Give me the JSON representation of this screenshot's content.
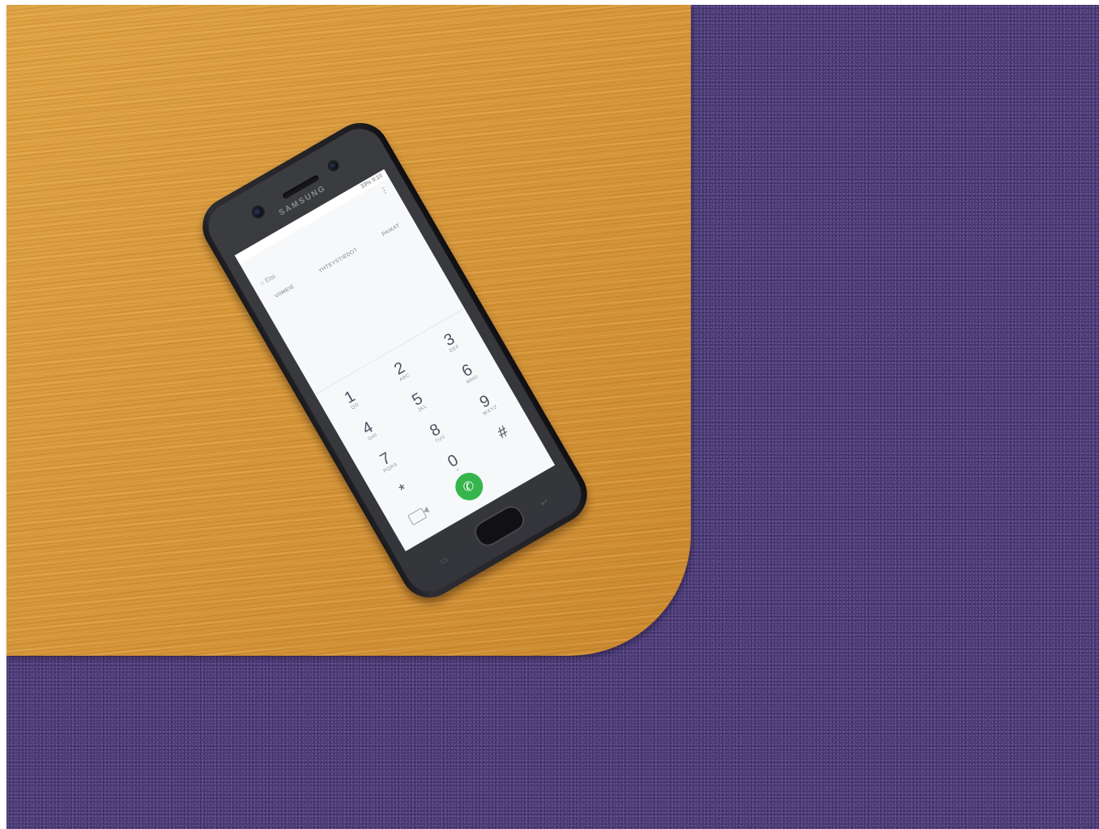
{
  "phone": {
    "brand": "SAMSUNG",
    "status": "33% 9:10",
    "search_placeholder": "Etsi",
    "tabs": [
      "VIIMEIE",
      "YHTEYSTIEDOT",
      "PAIKAT"
    ],
    "keys": [
      {
        "digit": "1",
        "letters": "QO"
      },
      {
        "digit": "2",
        "letters": "ABC"
      },
      {
        "digit": "3",
        "letters": "DEF"
      },
      {
        "digit": "4",
        "letters": "GHI"
      },
      {
        "digit": "5",
        "letters": "JKL"
      },
      {
        "digit": "6",
        "letters": "MNO"
      },
      {
        "digit": "7",
        "letters": "PQRS"
      },
      {
        "digit": "8",
        "letters": "TUV"
      },
      {
        "digit": "9",
        "letters": "WXYZ"
      },
      {
        "digit": "*",
        "letters": ""
      },
      {
        "digit": "0",
        "letters": "+"
      },
      {
        "digit": "#",
        "letters": ""
      }
    ],
    "icons": {
      "call": "phone-call-icon",
      "video": "video-call-icon",
      "back": "back-icon",
      "recent": "recent-apps-icon"
    },
    "call_color": "#36b54c"
  },
  "colors": {
    "table": "#d99a3b",
    "carpet": "#4a3a72"
  }
}
